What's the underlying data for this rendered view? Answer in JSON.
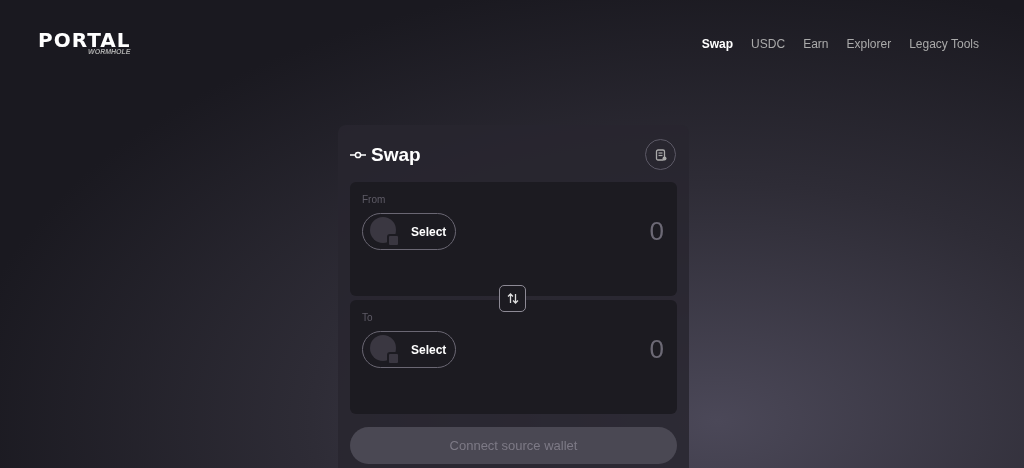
{
  "logo": {
    "title": "PORTAL",
    "subtitle": "WORMHOLE"
  },
  "nav": [
    {
      "label": "Swap",
      "selected": true
    },
    {
      "label": "USDC",
      "selected": false
    },
    {
      "label": "Earn",
      "selected": false
    },
    {
      "label": "Explorer",
      "selected": false
    },
    {
      "label": "Legacy Tools",
      "selected": false
    }
  ],
  "swap": {
    "title": "Swap",
    "panels": [
      {
        "label": "From",
        "token_button": "Select",
        "amount": "0"
      },
      {
        "label": "To",
        "token_button": "Select",
        "amount": "0"
      }
    ],
    "action": {
      "label": "Connect source wallet",
      "disabled": true
    }
  }
}
